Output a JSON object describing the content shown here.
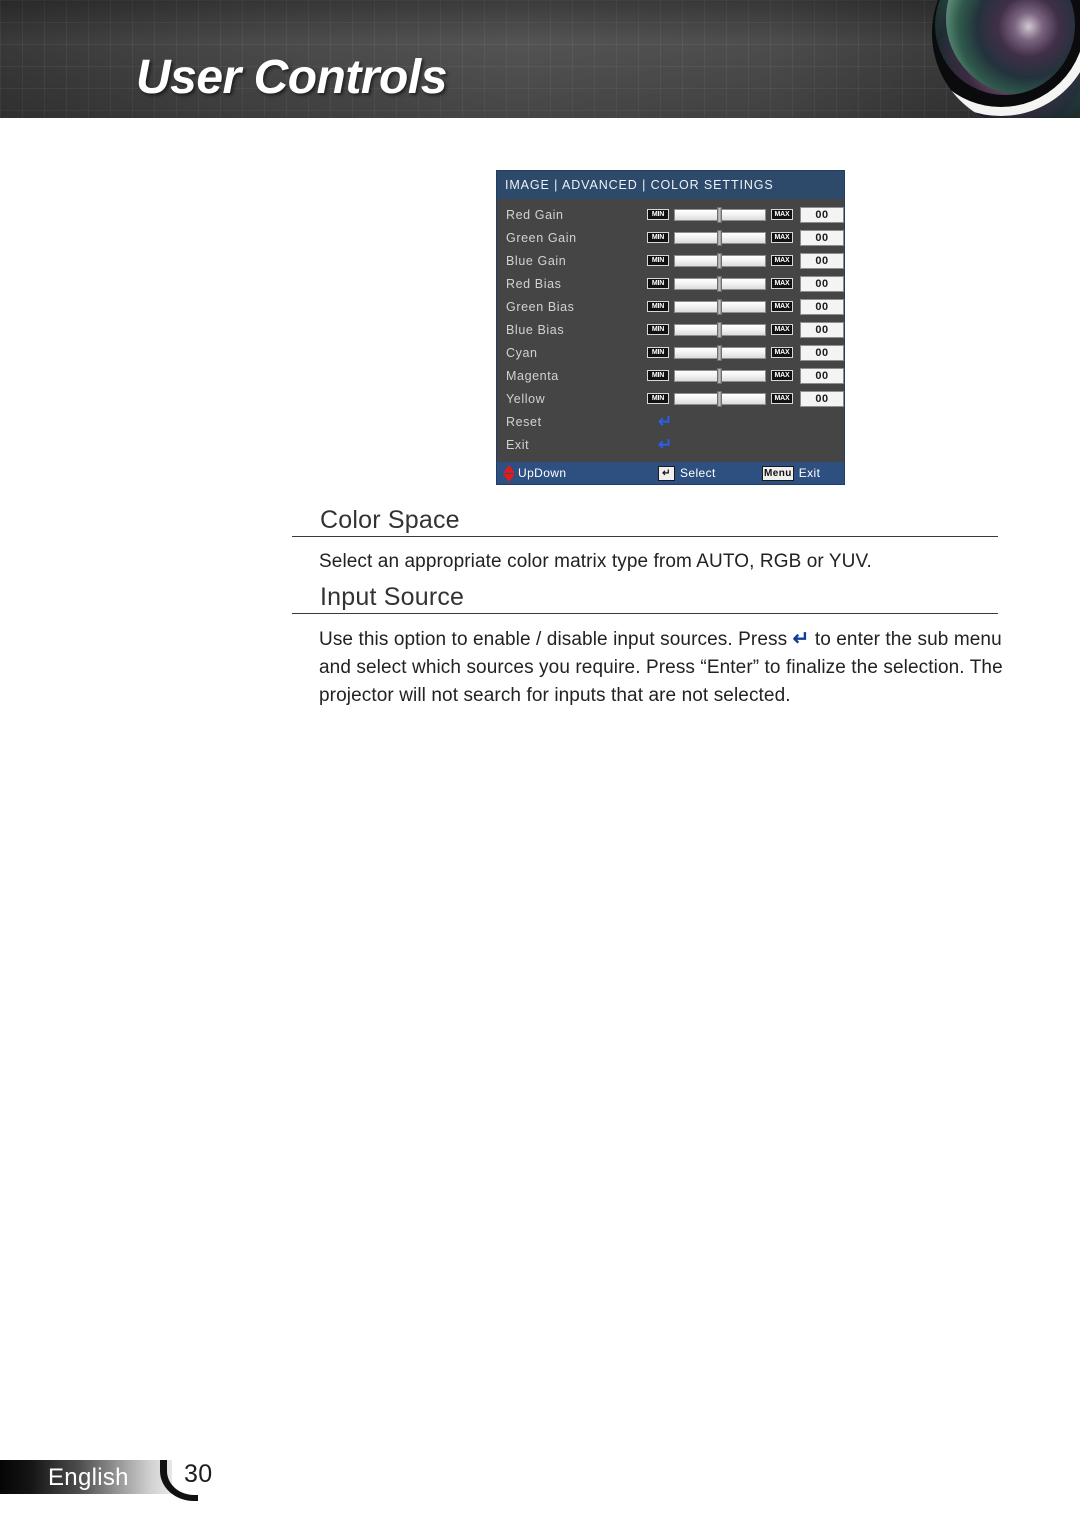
{
  "header": {
    "title": "User Controls",
    "lens_icon": "camera-lens-graphic"
  },
  "osd": {
    "title": "IMAGE | ADVANCED | COLOR SETTINGS",
    "min_label": "MIN",
    "max_label": "MAX",
    "slider_rows": [
      {
        "label": "Red Gain",
        "value": "00",
        "position_pct": 50
      },
      {
        "label": "Green Gain",
        "value": "00",
        "position_pct": 50
      },
      {
        "label": "Blue Gain",
        "value": "00",
        "position_pct": 50
      },
      {
        "label": "Red Bias",
        "value": "00",
        "position_pct": 50
      },
      {
        "label": "Green Bias",
        "value": "00",
        "position_pct": 50
      },
      {
        "label": "Blue Bias",
        "value": "00",
        "position_pct": 50
      },
      {
        "label": "Cyan",
        "value": "00",
        "position_pct": 50
      },
      {
        "label": "Magenta",
        "value": "00",
        "position_pct": 50
      },
      {
        "label": "Yellow",
        "value": "00",
        "position_pct": 50
      }
    ],
    "action_rows": [
      {
        "label": "Reset",
        "glyph": "↵"
      },
      {
        "label": "Exit",
        "glyph": "↵"
      }
    ],
    "footer": {
      "updown_label": "UpDown",
      "updown_icon": "up-down-arrows-icon",
      "select_key": "↵",
      "select_label": "Select",
      "exit_key": "Menu",
      "exit_label": "Exit"
    },
    "colors": {
      "titlebar": "#2d4a6b",
      "panel": "#454545",
      "footer_bar": "#2d5080",
      "enter_arrow": "#2a5fe0",
      "updown_arrow": "#e01b1b"
    }
  },
  "content": {
    "sections": [
      {
        "heading": "Color Space",
        "body_before": "Select an appropriate color matrix type from AUTO, RGB or YUV.",
        "body_after": ""
      },
      {
        "heading": "Input Source",
        "body_before": "Use this option to enable / disable input sources. Press ",
        "inline_glyph": "↵",
        "body_after": " to enter the sub menu and select which sources you require. Press “Enter” to finalize the selection. The projector will not search for inputs that are not selected."
      }
    ]
  },
  "footer": {
    "language": "English",
    "page_number": "30"
  }
}
